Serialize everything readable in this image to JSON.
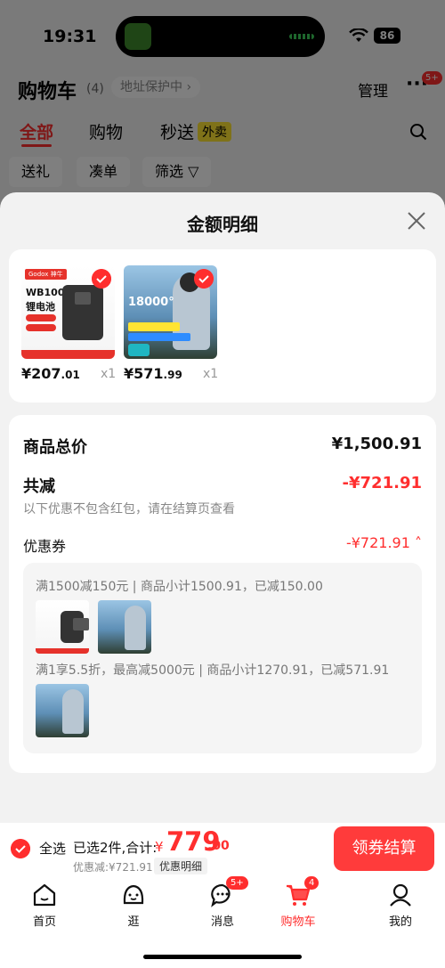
{
  "status": {
    "time": "19:31",
    "battery": "86"
  },
  "background": {
    "title": "购物车",
    "count": "(4)",
    "address": "地址保护中 ›",
    "manage": "管理",
    "more_badge": "5+",
    "tabs": [
      "全部",
      "购物",
      "秒送"
    ],
    "tab_tag": "外卖",
    "filters": [
      "送礼",
      "凑单",
      "筛选 ▽"
    ]
  },
  "sheet": {
    "title": "金额明细",
    "products": [
      {
        "brand": "Godox 神牛",
        "line1": "WB100",
        "line2": "锂电池",
        "price_int": "¥207",
        "price_dec": ".01",
        "qty": "x1"
      },
      {
        "number": "18000°",
        "price_int": "¥571",
        "price_dec": ".99",
        "qty": "x1"
      }
    ],
    "total_label": "商品总价",
    "total_value": "¥1,500.91",
    "reduction_label": "共减",
    "reduction_value": "-¥721.91",
    "reduction_note": "以下优惠不包含红包，请在结算页查看",
    "coupon_label": "优惠券",
    "coupon_value": "-¥721.91 ˄",
    "coupon_rules": [
      "满1500减150元 | 商品小计1500.91，已减150.00",
      "满1享5.5折，最高减5000元 | 商品小计1270.91，已减571.91"
    ]
  },
  "checkout": {
    "select_all": "全选",
    "selected": "已选2件,合计:",
    "currency": "¥",
    "total_int": "779",
    "total_dec": ".00",
    "discount": "优惠减:¥721.91",
    "detail_toggle": "优惠明细",
    "button": "领券结算"
  },
  "tabbar": [
    {
      "label": "首页",
      "icon": "home-icon"
    },
    {
      "label": "逛",
      "icon": "browse-icon"
    },
    {
      "label": "消息",
      "icon": "message-icon",
      "badge": "5+"
    },
    {
      "label": "购物车",
      "icon": "cart-icon",
      "badge": "4"
    },
    {
      "label": "我的",
      "icon": "profile-icon"
    }
  ],
  "colors": {
    "accent": "#ff2e2e",
    "tag": "#ffe433"
  }
}
